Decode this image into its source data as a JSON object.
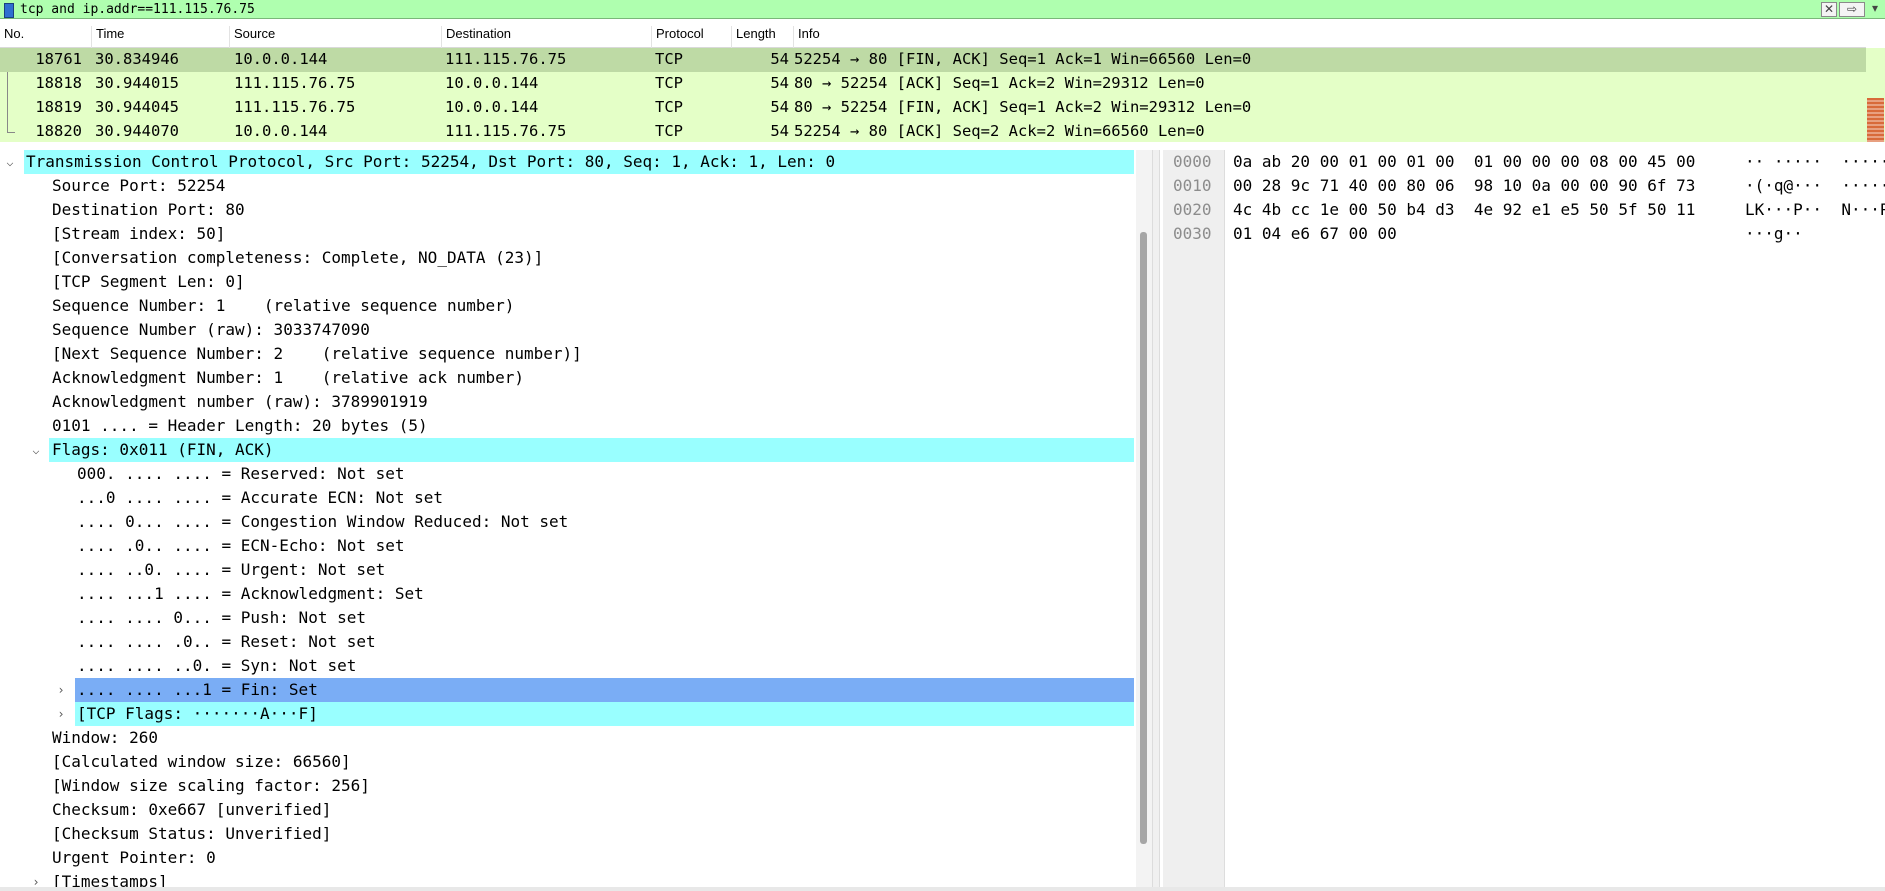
{
  "filter": {
    "text": "tcp and ip.addr==111.115.76.75",
    "clear_label": "✕",
    "apply_label": "⇨",
    "dropdown_label": "▾"
  },
  "packet_list": {
    "columns": [
      "No.",
      "Time",
      "Source",
      "Destination",
      "Protocol",
      "Length",
      "Info"
    ],
    "rows": [
      {
        "no": "18761",
        "time": "30.834946",
        "source": "10.0.0.144",
        "destination": "111.115.76.75",
        "protocol": "TCP",
        "length": "54",
        "info": "52254 → 80 [FIN, ACK] Seq=1 Ack=1 Win=66560 Len=0"
      },
      {
        "no": "18818",
        "time": "30.944015",
        "source": "111.115.76.75",
        "destination": "10.0.0.144",
        "protocol": "TCP",
        "length": "54",
        "info": "80 → 52254 [ACK] Seq=1 Ack=2 Win=29312 Len=0"
      },
      {
        "no": "18819",
        "time": "30.944045",
        "source": "111.115.76.75",
        "destination": "10.0.0.144",
        "protocol": "TCP",
        "length": "54",
        "info": "80 → 52254 [FIN, ACK] Seq=1 Ack=2 Win=29312 Len=0"
      },
      {
        "no": "18820",
        "time": "30.944070",
        "source": "10.0.0.144",
        "destination": "111.115.76.75",
        "protocol": "TCP",
        "length": "54",
        "info": "52254 → 80 [ACK] Seq=2 Ack=2 Win=66560 Len=0"
      }
    ],
    "row_color": "#e4ffc7",
    "selected_color": "#bedaa5"
  },
  "details": {
    "header": "Transmission Control Protocol, Src Port: 52254, Dst Port: 80, Seq: 1, Ack: 1, Len: 0",
    "fields": [
      "Source Port: 52254",
      "Destination Port: 80",
      "[Stream index: 50]",
      "[Conversation completeness: Complete, NO_DATA (23)]",
      "[TCP Segment Len: 0]",
      "Sequence Number: 1    (relative sequence number)",
      "Sequence Number (raw): 3033747090",
      "[Next Sequence Number: 2    (relative sequence number)]",
      "Acknowledgment Number: 1    (relative ack number)",
      "Acknowledgment number (raw): 3789901919",
      "0101 .... = Header Length: 20 bytes (5)"
    ],
    "flags_header": "Flags: 0x011 (FIN, ACK)",
    "flag_bits": [
      "000. .... .... = Reserved: Not set",
      "...0 .... .... = Accurate ECN: Not set",
      ".... 0... .... = Congestion Window Reduced: Not set",
      ".... .0.. .... = ECN-Echo: Not set",
      ".... ..0. .... = Urgent: Not set",
      ".... ...1 .... = Acknowledgment: Set",
      ".... .... 0... = Push: Not set",
      ".... .... .0.. = Reset: Not set",
      ".... .... ..0. = Syn: Not set"
    ],
    "fin_bit": ".... .... ...1 = Fin: Set",
    "tcp_flags": "[TCP Flags: ·······A···F]",
    "trailing": [
      "Window: 260",
      "[Calculated window size: 66560]",
      "[Window size scaling factor: 256]",
      "Checksum: 0xe667 [unverified]",
      "[Checksum Status: Unverified]",
      "Urgent Pointer: 0"
    ],
    "timestamps": "[Timestamps]",
    "highlight_color": "#99ffff",
    "selected_color": "#7aadf5"
  },
  "bytes": {
    "rows": [
      {
        "offset": "0000",
        "hex": "0a ab 20 00 01 00 01 00  01 00 00 00 08 00 45 00",
        "ascii": "·· ·····  ·····E·"
      },
      {
        "offset": "0010",
        "hex": "00 28 9c 71 40 00 80 06  98 10 0a 00 00 90 6f 73",
        "ascii": "·(·q@···  ······os"
      },
      {
        "offset": "0020",
        "hex": "4c 4b cc 1e 00 50 b4 d3  4e 92 e1 e5 50 5f 50 11",
        "ascii": "LK···P··  N···P_P·"
      },
      {
        "offset": "0030",
        "hex": "01 04 e6 67 00 00",
        "ascii": "···g··"
      }
    ]
  }
}
